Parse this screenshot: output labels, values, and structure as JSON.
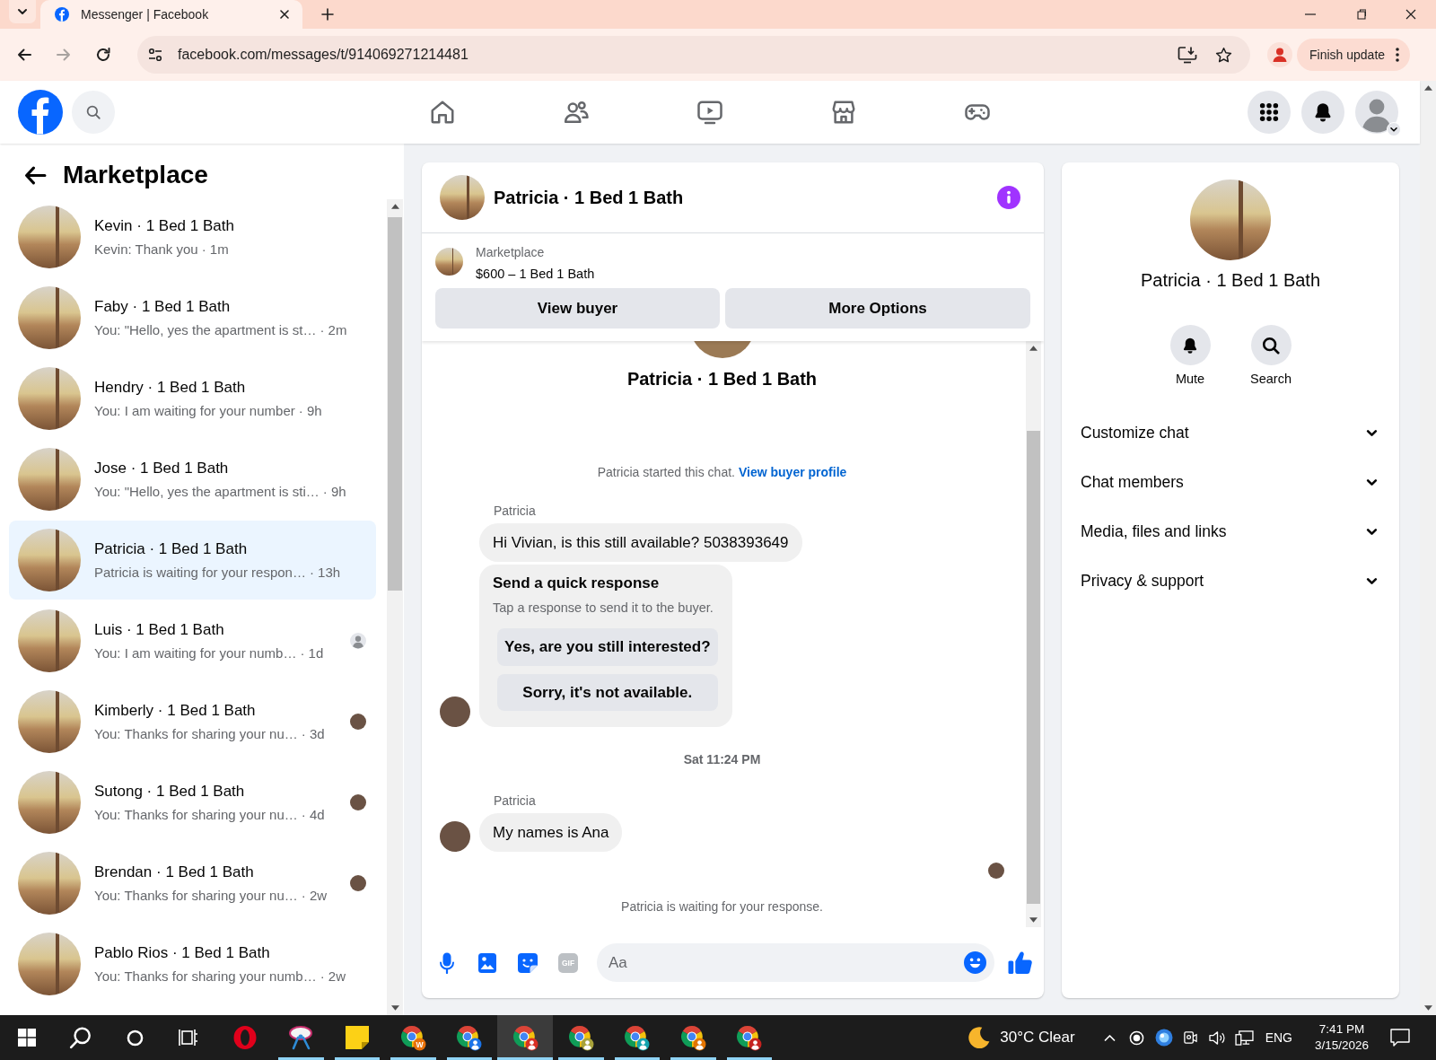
{
  "browser": {
    "tabs": [
      {
        "title": "Messenger | Facebook",
        "selected": true
      }
    ],
    "can_go_back": true,
    "can_go_forward": false,
    "address": "facebook.com/messages/t/914069271214481",
    "update_button": "Finish update"
  },
  "sidebar": {
    "title": "Marketplace",
    "conversations": [
      {
        "name": "Kevin · 1 Bed 1 Bath",
        "preview": "Kevin: Thank you",
        "time": "· 1m",
        "selected": false
      },
      {
        "name": "Faby · 1 Bed 1 Bath",
        "preview": "You: \"Hello, yes the apartment is st…",
        "time": "· 2m",
        "selected": false
      },
      {
        "name": "Hendry · 1 Bed 1 Bath",
        "preview": "You: I am waiting for your number",
        "time": "· 9h",
        "selected": false
      },
      {
        "name": "Jose · 1 Bed 1 Bath",
        "preview": "You: \"Hello, yes the apartment is sti…",
        "time": "· 9h",
        "selected": false
      },
      {
        "name": "Patricia · 1 Bed 1 Bath",
        "preview": "Patricia is waiting for your respon…",
        "time": "· 13h",
        "selected": true
      },
      {
        "name": "Luis · 1 Bed 1 Bath",
        "preview": "You: I am waiting for your numb…",
        "time": "· 1d",
        "selected": false,
        "read_receipt": {
          "kind": "generic"
        }
      },
      {
        "name": "Kimberly · 1 Bed 1 Bath",
        "preview": "You: Thanks for sharing your nu…",
        "time": "· 3d",
        "selected": false,
        "read_receipt": {
          "kind": "photo"
        }
      },
      {
        "name": "Sutong · 1 Bed 1 Bath",
        "preview": "You: Thanks for sharing your nu…",
        "time": "· 4d",
        "selected": false,
        "read_receipt": {
          "kind": "photo"
        }
      },
      {
        "name": "Brendan · 1 Bed 1 Bath",
        "preview": "You: Thanks for sharing your nu…",
        "time": "· 2w",
        "selected": false,
        "read_receipt": {
          "kind": "photo"
        }
      },
      {
        "name": "Pablo Rios · 1 Bed 1 Bath",
        "preview": "You: Thanks for sharing your numb…",
        "time": "· 2w",
        "selected": false
      }
    ]
  },
  "chat": {
    "header": {
      "title": "Patricia · 1 Bed 1 Bath"
    },
    "listing": {
      "label": "Marketplace",
      "title": "$600 – 1 Bed 1 Bath"
    },
    "actions": [
      "View buyer",
      "More Options"
    ],
    "intro": {
      "title": "Patricia · 1 Bed 1 Bath"
    },
    "thread": [
      {
        "kind": "notice",
        "text": "Patricia started this chat.",
        "link": "View buyer profile"
      },
      {
        "kind": "group",
        "sender": "Patricia",
        "seen": false,
        "messages": [
          {
            "kind": "text",
            "text": "Hi Vivian, is this still available? 5038393649"
          },
          {
            "kind": "quick_response",
            "title": "Send a quick response",
            "hint": "Tap a response to send it to the buyer.",
            "options": [
              "Yes, are you still interested?",
              "Sorry, it's not available."
            ]
          }
        ]
      },
      {
        "kind": "timestamp",
        "text": "Sat 11:24 PM"
      },
      {
        "kind": "group",
        "sender": "Patricia",
        "seen": true,
        "messages": [
          {
            "kind": "text",
            "text": "My names is Ana"
          }
        ]
      },
      {
        "kind": "notice",
        "text": "Patricia is waiting for your response."
      }
    ],
    "composer": {
      "gif_label": "GIF",
      "placeholder": "Aa"
    }
  },
  "info_panel": {
    "title": "Patricia · 1 Bed 1 Bath",
    "actions": [
      {
        "kind": "mute",
        "label": "Mute"
      },
      {
        "kind": "search",
        "label": "Search"
      }
    ],
    "sections": [
      {
        "label": "Customize chat",
        "expanded": false
      },
      {
        "label": "Chat members",
        "expanded": false
      },
      {
        "label": "Media, files and links",
        "expanded": false
      },
      {
        "label": "Privacy & support",
        "expanded": false
      }
    ]
  },
  "taskbar": {
    "apps": [
      {
        "kind": "opera",
        "running": false,
        "active": false
      },
      {
        "kind": "sketch",
        "running": true,
        "active": false
      },
      {
        "kind": "notes",
        "running": true,
        "active": false
      },
      {
        "kind": "chrome",
        "color": "#e8710a",
        "badge_text": "W",
        "running": true,
        "active": false
      },
      {
        "kind": "chrome",
        "color": "#1a73e8",
        "running": true,
        "active": false
      },
      {
        "kind": "chrome",
        "color": "#d93025",
        "running": true,
        "active": true
      },
      {
        "kind": "chrome",
        "color": "#a8a23a",
        "running": true,
        "active": false
      },
      {
        "kind": "chrome",
        "color": "#12a4af",
        "running": true,
        "active": false
      },
      {
        "kind": "chrome",
        "color": "#e37400",
        "running": true,
        "active": false
      },
      {
        "kind": "chrome",
        "color": "#c5221f",
        "running": true,
        "active": false
      }
    ],
    "weather": "30°C Clear",
    "language": "ENG",
    "time": "7:41 PM",
    "date": "3/15/2026"
  }
}
